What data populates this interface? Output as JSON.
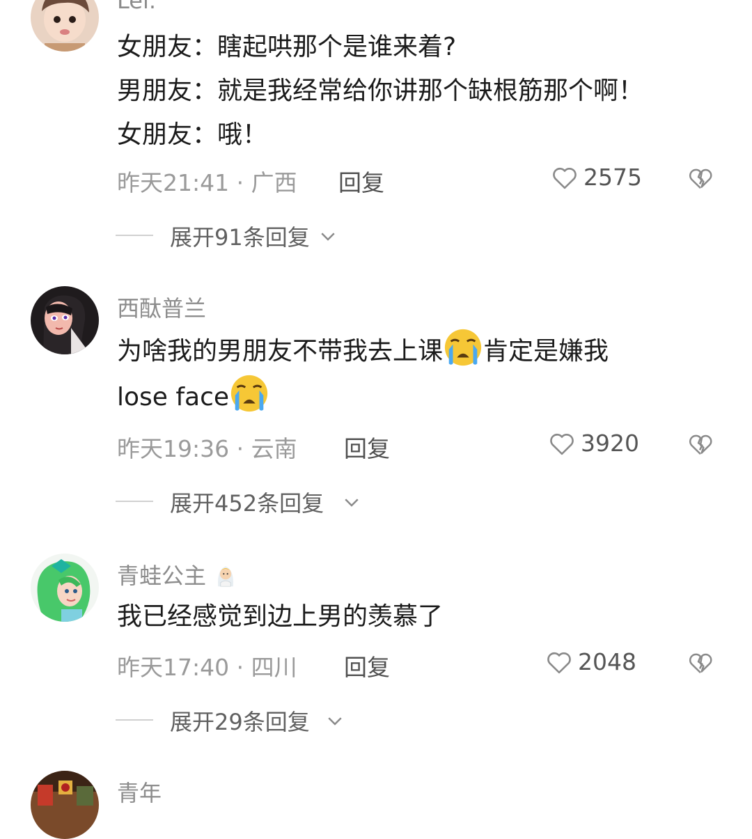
{
  "comments": [
    {
      "username": "Lei.",
      "lines": [
        "女朋友：瞎起哄那个是谁来着?",
        "男朋友：就是我经常给你讲那个缺根筋那个啊！",
        "女朋友：哦！"
      ],
      "time": "昨天21:41 · 广西",
      "reply_label": "回复",
      "likes": "2575",
      "expand_label": "展开91条回复"
    },
    {
      "username": "西酞普兰",
      "line1": "为啥我的男朋友不带我去上课",
      "line1b": "肯定是嫌我",
      "line2": "lose face",
      "emoji": "loudly-crying-face-emoji",
      "time": "昨天19:36 · 云南",
      "reply_label": "回复",
      "likes": "3920",
      "expand_label": "展开452条回复"
    },
    {
      "username": "青蛙公主",
      "username_emoji": "person-with-veil-emoji",
      "lines": [
        "我已经感觉到边上男的羡慕了"
      ],
      "time": "昨天17:40 · 四川",
      "reply_label": "回复",
      "likes": "2048",
      "expand_label": "展开29条回复"
    },
    {
      "username": "青年"
    }
  ],
  "icons": {
    "like": "heart-outline-icon",
    "dislike": "broken-heart-icon",
    "expand": "chevron-down-icon"
  },
  "colors": {
    "text": "#1b1b1b",
    "meta": "#9a9a9a",
    "username": "#8c8c8c"
  }
}
